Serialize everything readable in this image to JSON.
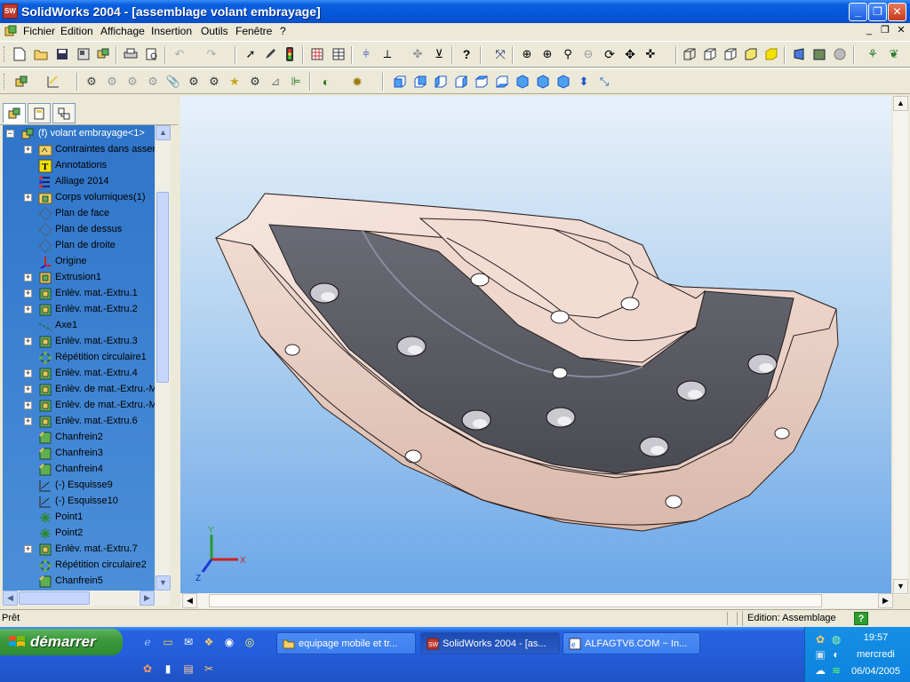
{
  "window": {
    "title": "SolidWorks 2004 - [assemblage volant embrayage]",
    "app_badge": "SW",
    "min_glyph": "_",
    "restore_glyph": "❐",
    "close_glyph": "✕"
  },
  "menu": {
    "items": [
      "Fichier",
      "Edition",
      "Affichage",
      "Insertion",
      "Outils",
      "Fenêtre",
      "?"
    ],
    "doc_min": "_",
    "doc_restore": "❐",
    "doc_close": "✕"
  },
  "tree": {
    "root": "(f) volant embrayage<1>",
    "items": [
      {
        "label": "Contraintes dans assem",
        "icon": "mates-folder-icon",
        "expand": "+"
      },
      {
        "label": "Annotations",
        "icon": "annotations-icon",
        "expand": ""
      },
      {
        "label": "Alliage 2014",
        "icon": "material-icon",
        "expand": ""
      },
      {
        "label": "Corps volumiques(1)",
        "icon": "solid-bodies-icon",
        "expand": "+"
      },
      {
        "label": "Plan de face",
        "icon": "plane-icon",
        "expand": ""
      },
      {
        "label": "Plan de dessus",
        "icon": "plane-icon",
        "expand": ""
      },
      {
        "label": "Plan de droite",
        "icon": "plane-icon",
        "expand": ""
      },
      {
        "label": "Origine",
        "icon": "origin-icon",
        "expand": ""
      },
      {
        "label": "Extrusion1",
        "icon": "extrude-icon",
        "expand": "+"
      },
      {
        "label": "Enlèv. mat.-Extru.1",
        "icon": "cut-extrude-icon",
        "expand": "+"
      },
      {
        "label": "Enlèv. mat.-Extru.2",
        "icon": "cut-extrude-icon",
        "expand": "+"
      },
      {
        "label": "Axe1",
        "icon": "axis-icon",
        "expand": ""
      },
      {
        "label": "Enlèv. mat.-Extru.3",
        "icon": "cut-extrude-icon",
        "expand": "+"
      },
      {
        "label": "Répétition circulaire1",
        "icon": "circular-pattern-icon",
        "expand": ""
      },
      {
        "label": "Enlèv. mat.-Extru.4",
        "icon": "cut-extrude-icon",
        "expand": "+"
      },
      {
        "label": "Enlèv. de mat.-Extru.-M",
        "icon": "cut-extrude-icon",
        "expand": "+"
      },
      {
        "label": "Enlèv. de mat.-Extru.-M",
        "icon": "cut-extrude-icon",
        "expand": "+"
      },
      {
        "label": "Enlèv. mat.-Extru.6",
        "icon": "cut-extrude-icon",
        "expand": "+"
      },
      {
        "label": "Chanfrein2",
        "icon": "chamfer-icon",
        "expand": ""
      },
      {
        "label": "Chanfrein3",
        "icon": "chamfer-icon",
        "expand": ""
      },
      {
        "label": "Chanfrein4",
        "icon": "chamfer-icon",
        "expand": ""
      },
      {
        "label": "(-) Esquisse9",
        "icon": "sketch-icon",
        "expand": ""
      },
      {
        "label": "(-) Esquisse10",
        "icon": "sketch-icon",
        "expand": ""
      },
      {
        "label": "Point1",
        "icon": "point-icon",
        "expand": ""
      },
      {
        "label": "Point2",
        "icon": "point-icon",
        "expand": ""
      },
      {
        "label": "Enlèv. mat.-Extru.7",
        "icon": "cut-extrude-icon",
        "expand": "+"
      },
      {
        "label": "Répétition circulaire2",
        "icon": "circular-pattern-icon",
        "expand": ""
      },
      {
        "label": "Chanfrein5",
        "icon": "chamfer-icon",
        "expand": ""
      }
    ]
  },
  "triad": {
    "x": "X",
    "y": "Y",
    "z": "Z"
  },
  "status": {
    "ready": "Prêt",
    "edit_mode": "Edition: Assemblage",
    "help_glyph": "?"
  },
  "taskbar": {
    "start_label": "démarrer",
    "tasks": [
      {
        "label": "equipage mobile et tr...",
        "icon": "folder-icon"
      },
      {
        "label": "SolidWorks 2004 - [as...",
        "icon": "solidworks-icon"
      },
      {
        "label": "ALFAGTV6.COM ~ In...",
        "icon": "internet-explorer-icon"
      }
    ],
    "clock": {
      "time": "19:57",
      "day": "mercredi",
      "date": "06/04/2005"
    }
  },
  "colors": {
    "tree_bg": "#2f75c9",
    "part_face": "#f2dcd4",
    "friction_ring": "#5c5d66",
    "viewport_top": "#e8f1fa",
    "viewport_bottom": "#6aa6e8"
  }
}
